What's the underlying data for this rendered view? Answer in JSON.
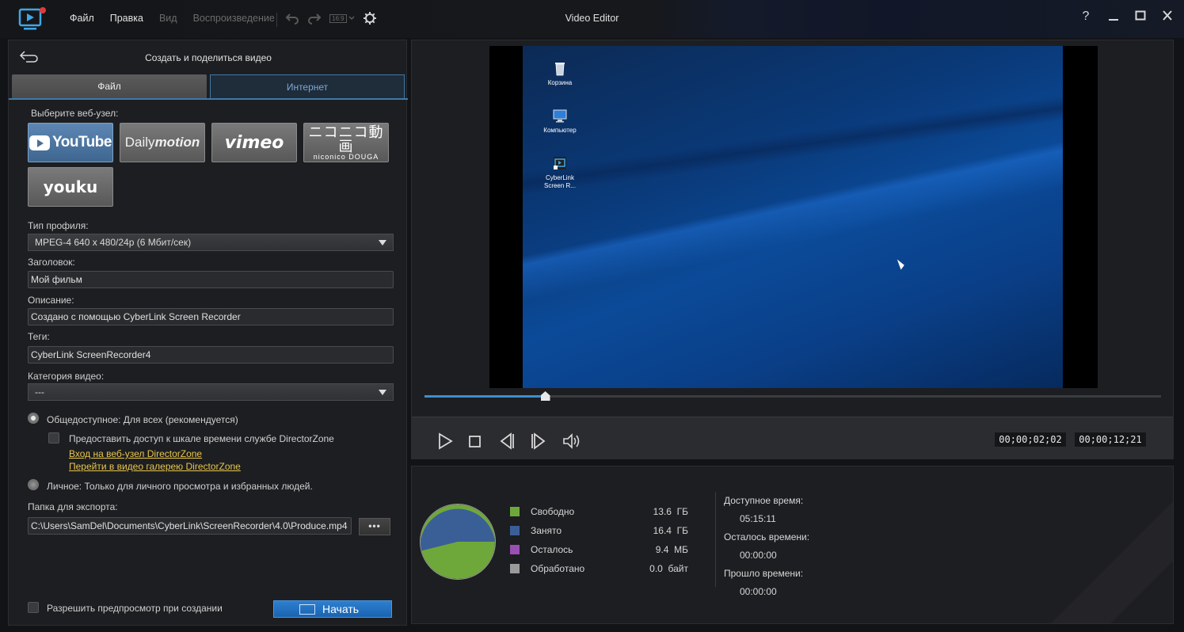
{
  "titlebar": {
    "title": "Video Editor",
    "menu": [
      "Файл",
      "Правка",
      "Вид",
      "Воспроизведение"
    ],
    "aspect_ratio": "16:9",
    "help_glyph": "?"
  },
  "left_panel": {
    "title": "Создать и поделиться видео",
    "tabs": [
      "Файл",
      "Интернет"
    ],
    "site_label": "Выберите веб-узел:",
    "sites": {
      "youtube": "YouTube",
      "dailymotion_a": "Daily",
      "dailymotion_b": "motion",
      "vimeo": "vimeo",
      "niconico_big": "ニコニコ動画",
      "niconico_small": "niconico DOUGA",
      "youku": "youku"
    },
    "profile_label": "Тип профиля:",
    "profile_value": "MPEG-4 640 x 480/24p (6 Мбит/сек)",
    "title_label": "Заголовок:",
    "title_value": "Мой фильм",
    "desc_label": "Описание:",
    "desc_value": "Создано с помощью CyberLink Screen Recorder",
    "tags_label": "Теги:",
    "tags_value": "CyberLink ScreenRecorder4",
    "category_label": "Категория видео:",
    "category_value": "---",
    "public_option": "Общедоступное: Для всех (рекомендуется)",
    "directorzone_check": "Предоставить доступ к шкале времени службе DirectorZone",
    "link_login": "Вход на веб-узел DirectorZone",
    "link_gallery": "Перейти в видео галерею DirectorZone",
    "private_option": "Личное: Только для личного просмотра и избранных людей.",
    "export_label": "Папка для экспорта:",
    "export_path": "C:\\Users\\SamDel\\Documents\\CyberLink\\ScreenRecorder\\4.0\\Produce.mp4",
    "browse_label": "•••",
    "preview_check": "Разрешить предпросмотр при создании",
    "start_label": "Начать"
  },
  "player": {
    "desktop_icons": [
      "Корзина",
      "Компьютер",
      "CyberLink Screen R..."
    ],
    "progress_fraction": 0.164,
    "time_current": "00;00;02;02",
    "time_total": "00;00;12;21"
  },
  "stats": {
    "legend": [
      {
        "name": "Свободно",
        "value": "13.6  ГБ",
        "color": "#6fa83a"
      },
      {
        "name": "Занято",
        "value": "16.4  ГБ",
        "color": "#3a5f97"
      },
      {
        "name": "Осталось",
        "value": "9.4  МБ",
        "color": "#9a4fb5"
      },
      {
        "name": "Обработано",
        "value": "0.0  байт",
        "color": "#9a9a9a"
      }
    ],
    "available_label": "Доступное время:",
    "available_value": "05:15:11",
    "remaining_label": "Осталось времени:",
    "remaining_value": "00:00:00",
    "elapsed_label": "Прошло времени:",
    "elapsed_value": "00:00:00"
  },
  "colors": {
    "accent": "#3d8ed0",
    "start_button": "#1f6fc0",
    "link": "#e8c64a"
  }
}
